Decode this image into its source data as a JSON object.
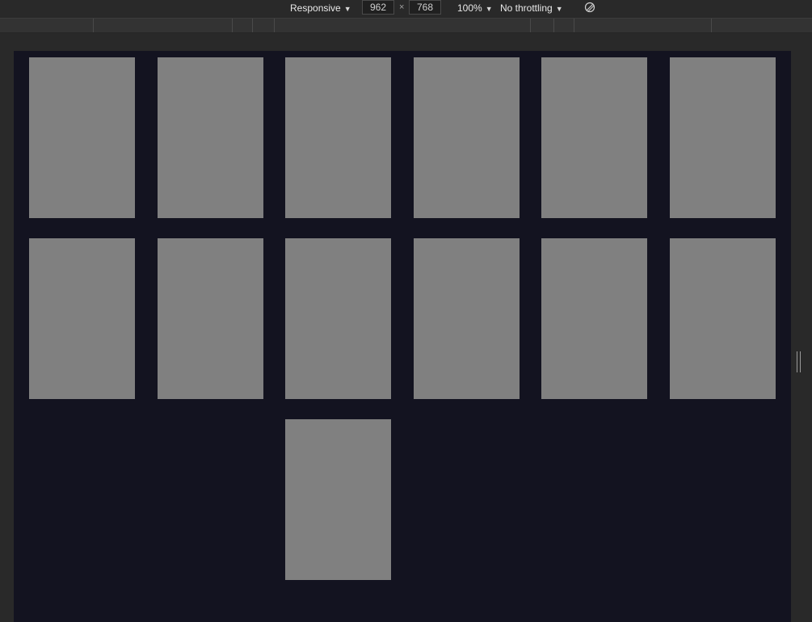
{
  "toolbar": {
    "device_mode": "Responsive",
    "width": "962",
    "times": "×",
    "height": "768",
    "zoom": "100%",
    "throttling": "No throttling",
    "rotate_icon": "rotate-icon"
  },
  "cards": [
    {
      "row": 1,
      "col": 1
    },
    {
      "row": 1,
      "col": 2
    },
    {
      "row": 1,
      "col": 3
    },
    {
      "row": 1,
      "col": 4
    },
    {
      "row": 1,
      "col": 5
    },
    {
      "row": 1,
      "col": 6
    },
    {
      "row": 2,
      "col": 1
    },
    {
      "row": 2,
      "col": 2
    },
    {
      "row": 2,
      "col": 3
    },
    {
      "row": 2,
      "col": 4
    },
    {
      "row": 2,
      "col": 5
    },
    {
      "row": 2,
      "col": 6
    },
    {
      "row": 3,
      "col": 3
    }
  ],
  "colors": {
    "viewport_bg": "#131320",
    "card": "#808080",
    "toolbar_bg": "#292929"
  }
}
